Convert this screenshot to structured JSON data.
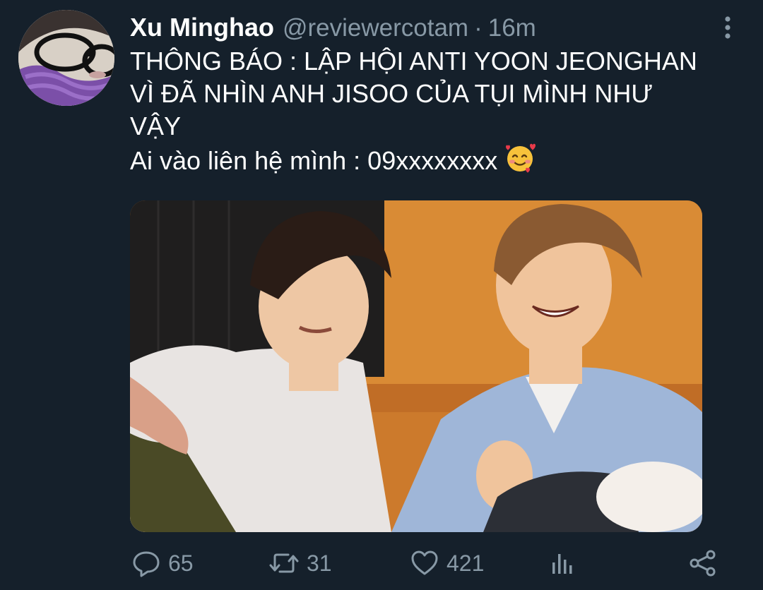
{
  "tweet": {
    "author": {
      "display_name": "Xu Minghao",
      "handle": "@reviewercotam"
    },
    "separator": "·",
    "time": "16m",
    "text_lines": [
      "THÔNG BÁO : LẬP HỘI ANTI YOON JEONGHAN",
      "VÌ ĐÃ NHÌN ANH JISOO CỦA TỤI MÌNH NHƯ",
      "VẬY",
      "Ai vào liên hệ mình : 09xxxxxxxx"
    ],
    "text_emoji": "smiling-face-with-hearts-icon",
    "actions": {
      "reply_count": "65",
      "retweet_count": "31",
      "like_count": "421"
    }
  },
  "icons": {
    "more": "more-vertical-icon",
    "reply": "reply-icon",
    "retweet": "retweet-icon",
    "like": "heart-icon",
    "analytics": "analytics-icon",
    "share": "share-icon"
  },
  "colors": {
    "background": "#15202b",
    "primary_text": "#ffffff",
    "secondary_text": "#8899a6"
  }
}
